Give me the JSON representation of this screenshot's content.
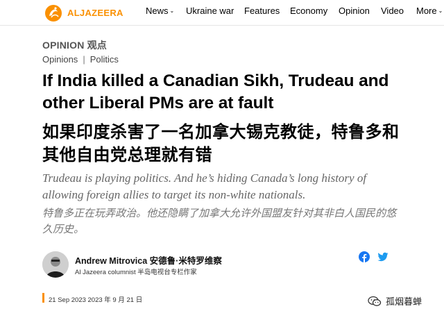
{
  "brand": {
    "logo_text": "ALJAZEERA",
    "accent": "#fa9000"
  },
  "nav": {
    "items": [
      {
        "label": "News",
        "has_dropdown": true
      },
      {
        "label": "Ukraine war",
        "has_dropdown": false
      },
      {
        "label": "Features",
        "has_dropdown": false
      },
      {
        "label": "Economy",
        "has_dropdown": false
      },
      {
        "label": "Opinion",
        "has_dropdown": false
      },
      {
        "label": "Video",
        "has_dropdown": false
      },
      {
        "label": "More",
        "has_dropdown": true
      }
    ]
  },
  "article": {
    "kicker": "OPINION 观点",
    "breadcrumb": [
      "Opinions",
      "Politics"
    ],
    "title_en": "If India killed a Canadian Sikh, Trudeau and other Liberal PMs are at fault",
    "title_zh": "如果印度杀害了一名加拿大锡克教徒，特鲁多和其他自由党总理就有错",
    "dek_en": "Trudeau is playing politics. And he’s hiding Canada’s long history of allowing foreign allies to target its non-white nationals.",
    "dek_zh": "特鲁多正在玩弄政治。他还隐瞒了加拿大允许外国盟友针对其非白人国民的悠久历史。",
    "author": {
      "name": "Andrew Mitrovica 安德鲁·米特罗维察",
      "role": "Al Jazeera columnist 半岛电视台专栏作家"
    },
    "date": "21 Sep 2023 2023 年 9 月 21 日",
    "share_icons": [
      "facebook-icon",
      "twitter-icon"
    ]
  },
  "watermark": {
    "text": "孤烟暮蝉",
    "icon": "wechat-icon"
  }
}
